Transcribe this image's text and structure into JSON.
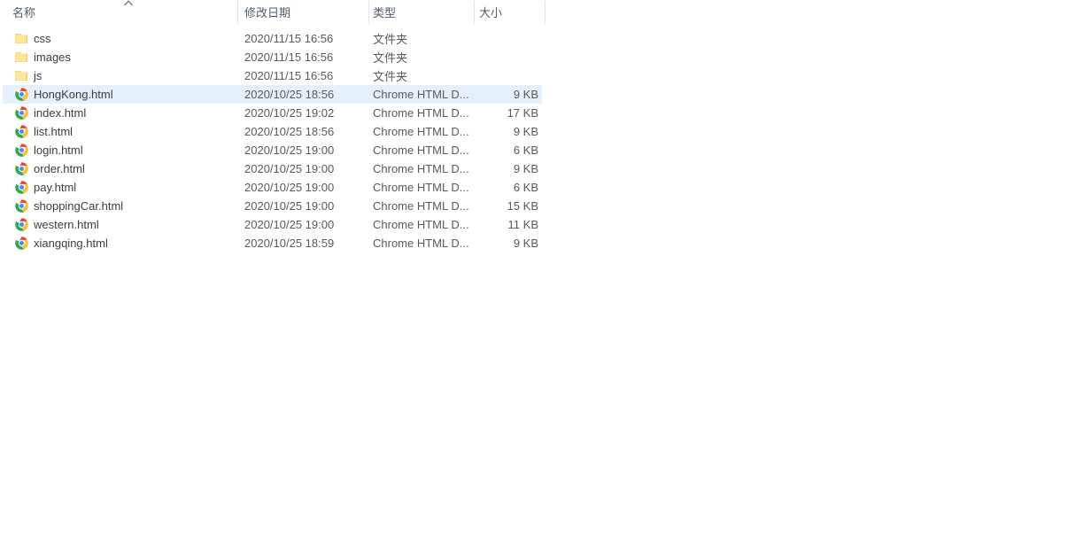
{
  "window": {
    "title": "File Explorer list view"
  },
  "columns": {
    "name": "名称",
    "date_modified": "修改日期",
    "type": "类型",
    "size": "大小",
    "sort_column": "名称",
    "sort_direction": "ascending",
    "sort_icon": "chevron-up-icon"
  },
  "colors": {
    "selection": "#e5f0fb",
    "header_text": "#4e5d6e",
    "row_text": "#3d3d3d",
    "secondary_text": "#5a5a5a",
    "separator": "#e2e2e2",
    "folder_fill": "#fbe08a",
    "folder_edge": "#f0c95a"
  },
  "files": [
    {
      "icon": "folder-icon",
      "name": "css",
      "date_modified": "2020/11/15 16:56",
      "type": "文件夹",
      "size": "",
      "selected": false
    },
    {
      "icon": "folder-icon",
      "name": "images",
      "date_modified": "2020/11/15 16:56",
      "type": "文件夹",
      "size": "",
      "selected": false
    },
    {
      "icon": "folder-icon",
      "name": "js",
      "date_modified": "2020/11/15 16:56",
      "type": "文件夹",
      "size": "",
      "selected": false
    },
    {
      "icon": "chrome-html-icon",
      "name": "HongKong.html",
      "date_modified": "2020/10/25 18:56",
      "type": "Chrome HTML D...",
      "size": "9 KB",
      "selected": true
    },
    {
      "icon": "chrome-html-icon",
      "name": "index.html",
      "date_modified": "2020/10/25 19:02",
      "type": "Chrome HTML D...",
      "size": "17 KB",
      "selected": false
    },
    {
      "icon": "chrome-html-icon",
      "name": "list.html",
      "date_modified": "2020/10/25 18:56",
      "type": "Chrome HTML D...",
      "size": "9 KB",
      "selected": false
    },
    {
      "icon": "chrome-html-icon",
      "name": "login.html",
      "date_modified": "2020/10/25 19:00",
      "type": "Chrome HTML D...",
      "size": "6 KB",
      "selected": false
    },
    {
      "icon": "chrome-html-icon",
      "name": "order.html",
      "date_modified": "2020/10/25 19:00",
      "type": "Chrome HTML D...",
      "size": "9 KB",
      "selected": false
    },
    {
      "icon": "chrome-html-icon",
      "name": "pay.html",
      "date_modified": "2020/10/25 19:00",
      "type": "Chrome HTML D...",
      "size": "6 KB",
      "selected": false
    },
    {
      "icon": "chrome-html-icon",
      "name": "shoppingCar.html",
      "date_modified": "2020/10/25 19:00",
      "type": "Chrome HTML D...",
      "size": "15 KB",
      "selected": false
    },
    {
      "icon": "chrome-html-icon",
      "name": "western.html",
      "date_modified": "2020/10/25 19:00",
      "type": "Chrome HTML D...",
      "size": "11 KB",
      "selected": false
    },
    {
      "icon": "chrome-html-icon",
      "name": "xiangqing.html",
      "date_modified": "2020/10/25 18:59",
      "type": "Chrome HTML D...",
      "size": "9 KB",
      "selected": false
    }
  ]
}
